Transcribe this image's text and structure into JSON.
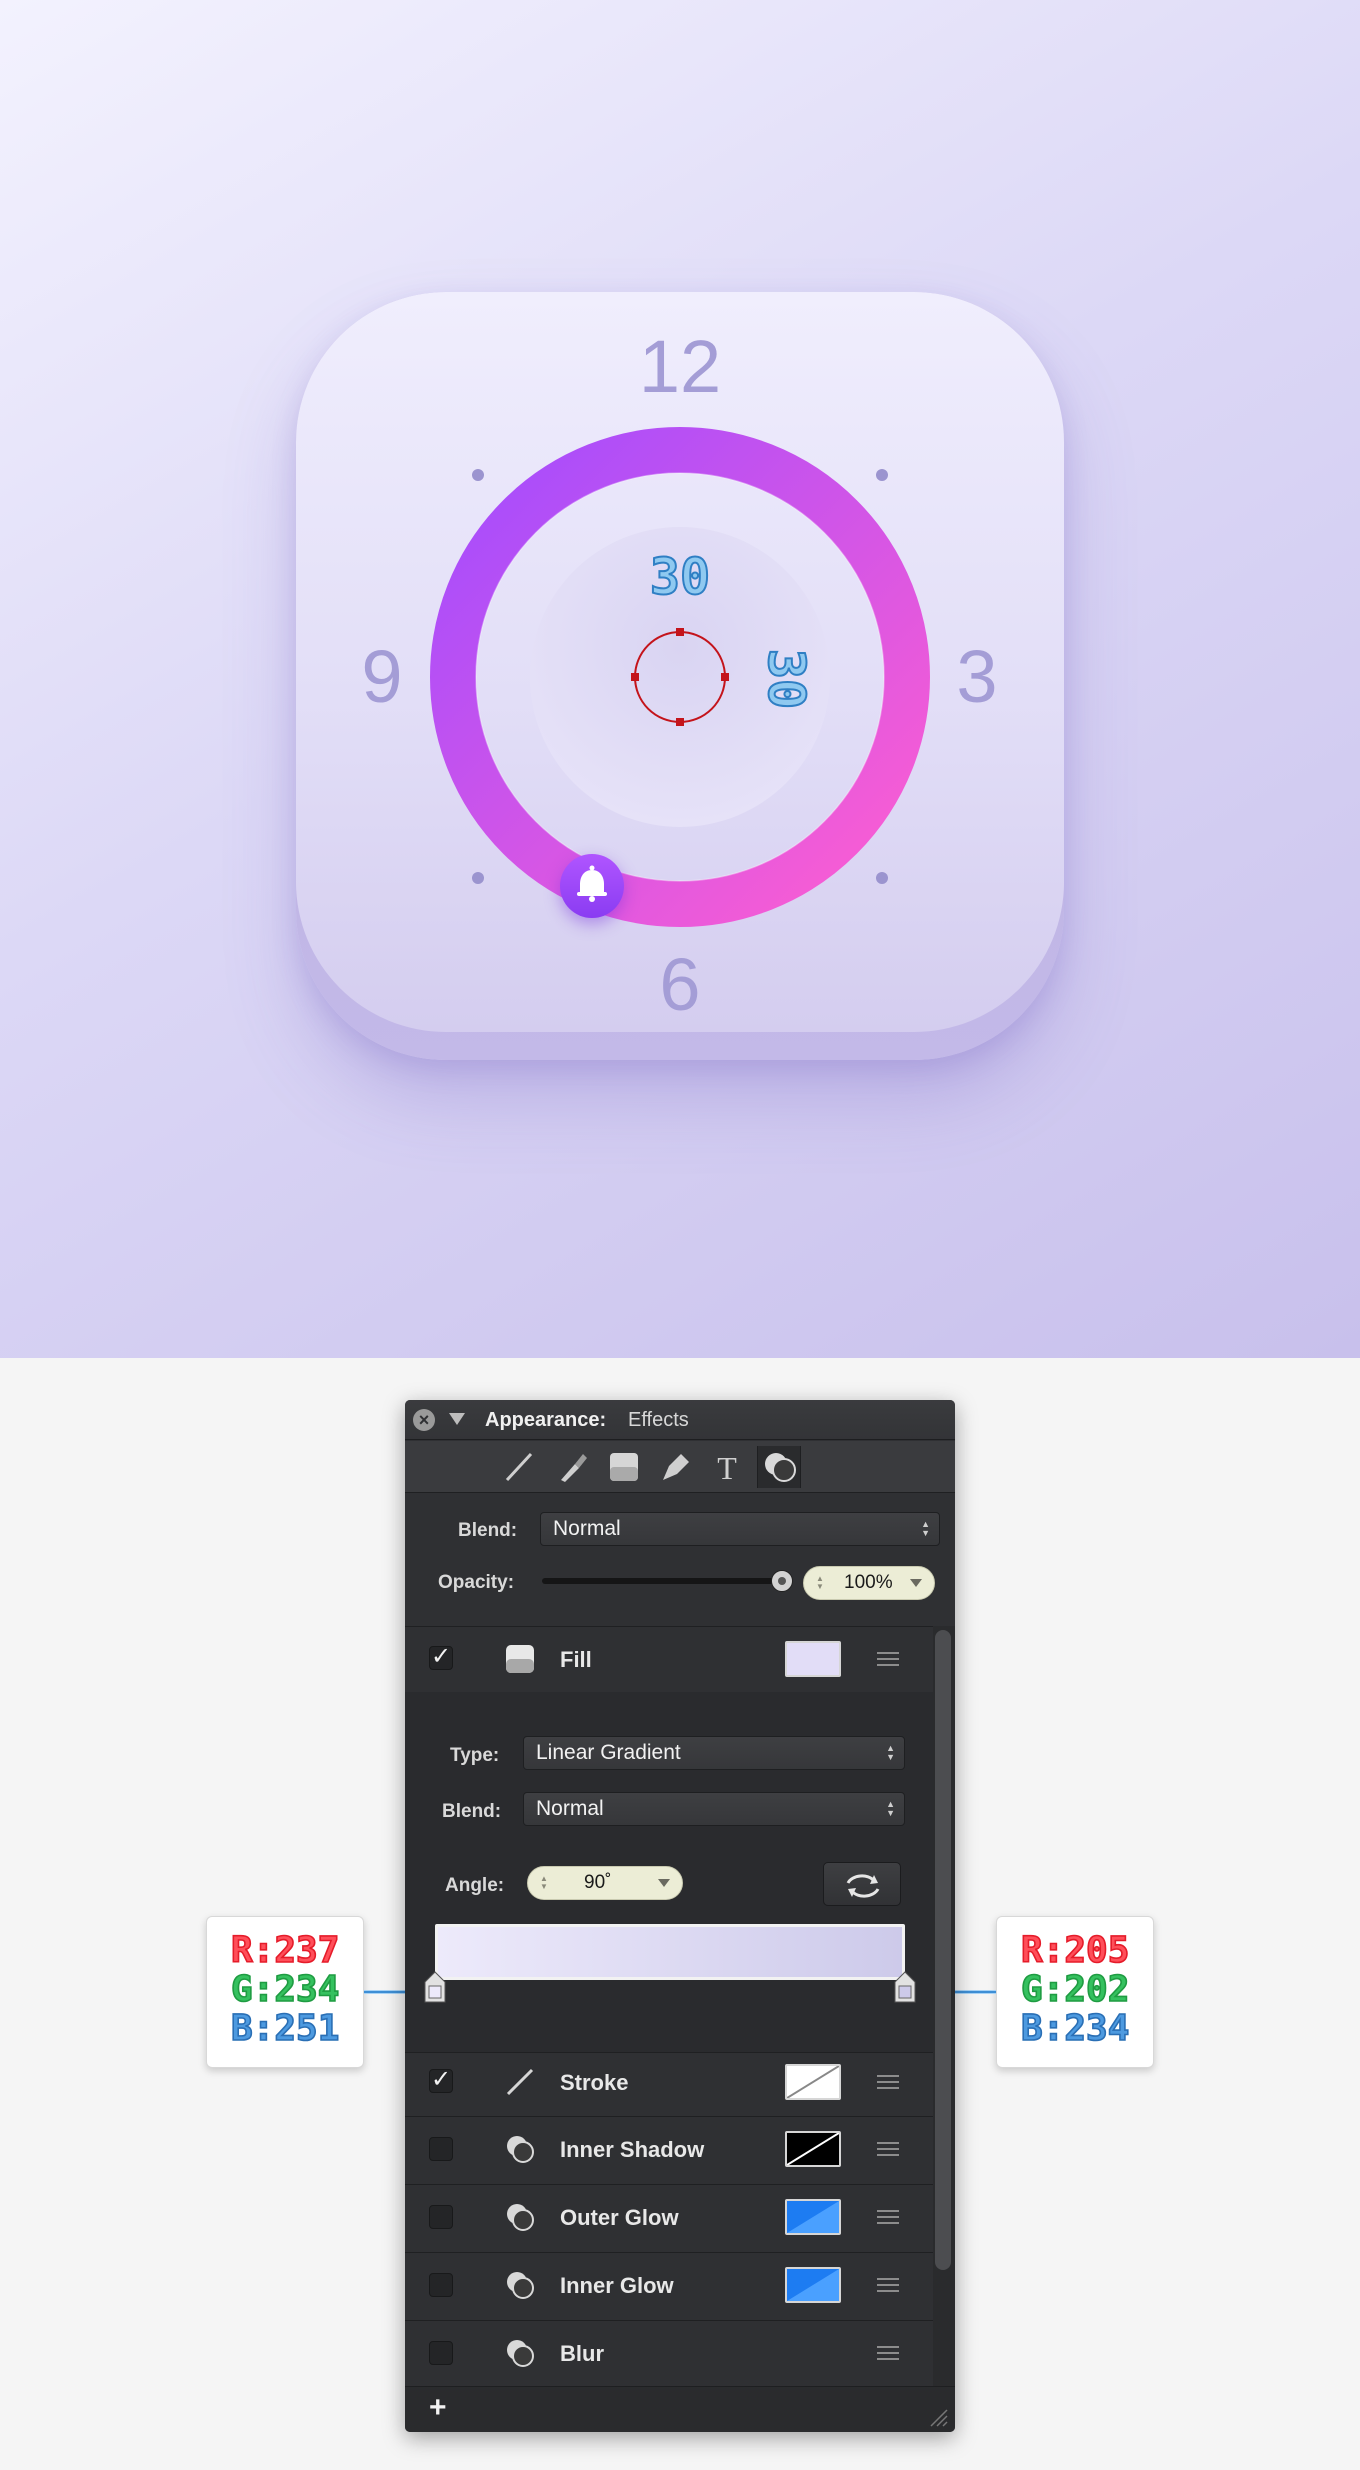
{
  "clock": {
    "hour_12": "12",
    "hour_3": "3",
    "hour_6": "6",
    "hour_9": "9",
    "measure_top": "30",
    "measure_right": "30",
    "ring_gradient": [
      "#a64bff",
      "#ff5fd2"
    ],
    "knob_color": "#9c45ff",
    "knob_icon": "bell-icon",
    "numeral_color": "#9f98d4"
  },
  "panel": {
    "title_label": "Appearance:",
    "title_value": "Effects",
    "tools": [
      "stroke-tool-icon",
      "brush-tool-icon",
      "fill-tool-icon",
      "pen-tool-icon",
      "text-tool-icon",
      "effects-tool-icon"
    ],
    "blend_label": "Blend:",
    "blend_value": "Normal",
    "opacity_label": "Opacity:",
    "opacity_value": "100%",
    "opacity_level": 1.0,
    "rows": [
      {
        "label": "Fill",
        "checked": true,
        "icon": "fill-icon",
        "swatch": "#e2ddf7"
      },
      {
        "label": "Stroke",
        "checked": true,
        "icon": "stroke-icon",
        "swatch": "none"
      },
      {
        "label": "Inner Shadow",
        "checked": false,
        "icon": "effect-icon",
        "swatch": "#000000"
      },
      {
        "label": "Outer Glow",
        "checked": false,
        "icon": "effect-icon",
        "swatch": "#1d7cf2"
      },
      {
        "label": "Inner Glow",
        "checked": false,
        "icon": "effect-icon",
        "swatch": "#1d7cf2"
      },
      {
        "label": "Blur",
        "checked": false,
        "icon": "effect-icon",
        "swatch": ""
      }
    ],
    "fill": {
      "type_label": "Type:",
      "type_value": "Linear Gradient",
      "blend_label": "Blend:",
      "blend_value": "Normal",
      "angle_label": "Angle:",
      "angle_value": "90˚",
      "gradient_start": "#edeafb",
      "gradient_end": "#cdcaea"
    },
    "add_label": "+"
  },
  "callouts": {
    "left": {
      "r": "R:237",
      "g": "G:234",
      "b": "B:251"
    },
    "right": {
      "r": "R:205",
      "g": "G:202",
      "b": "B:234"
    }
  }
}
